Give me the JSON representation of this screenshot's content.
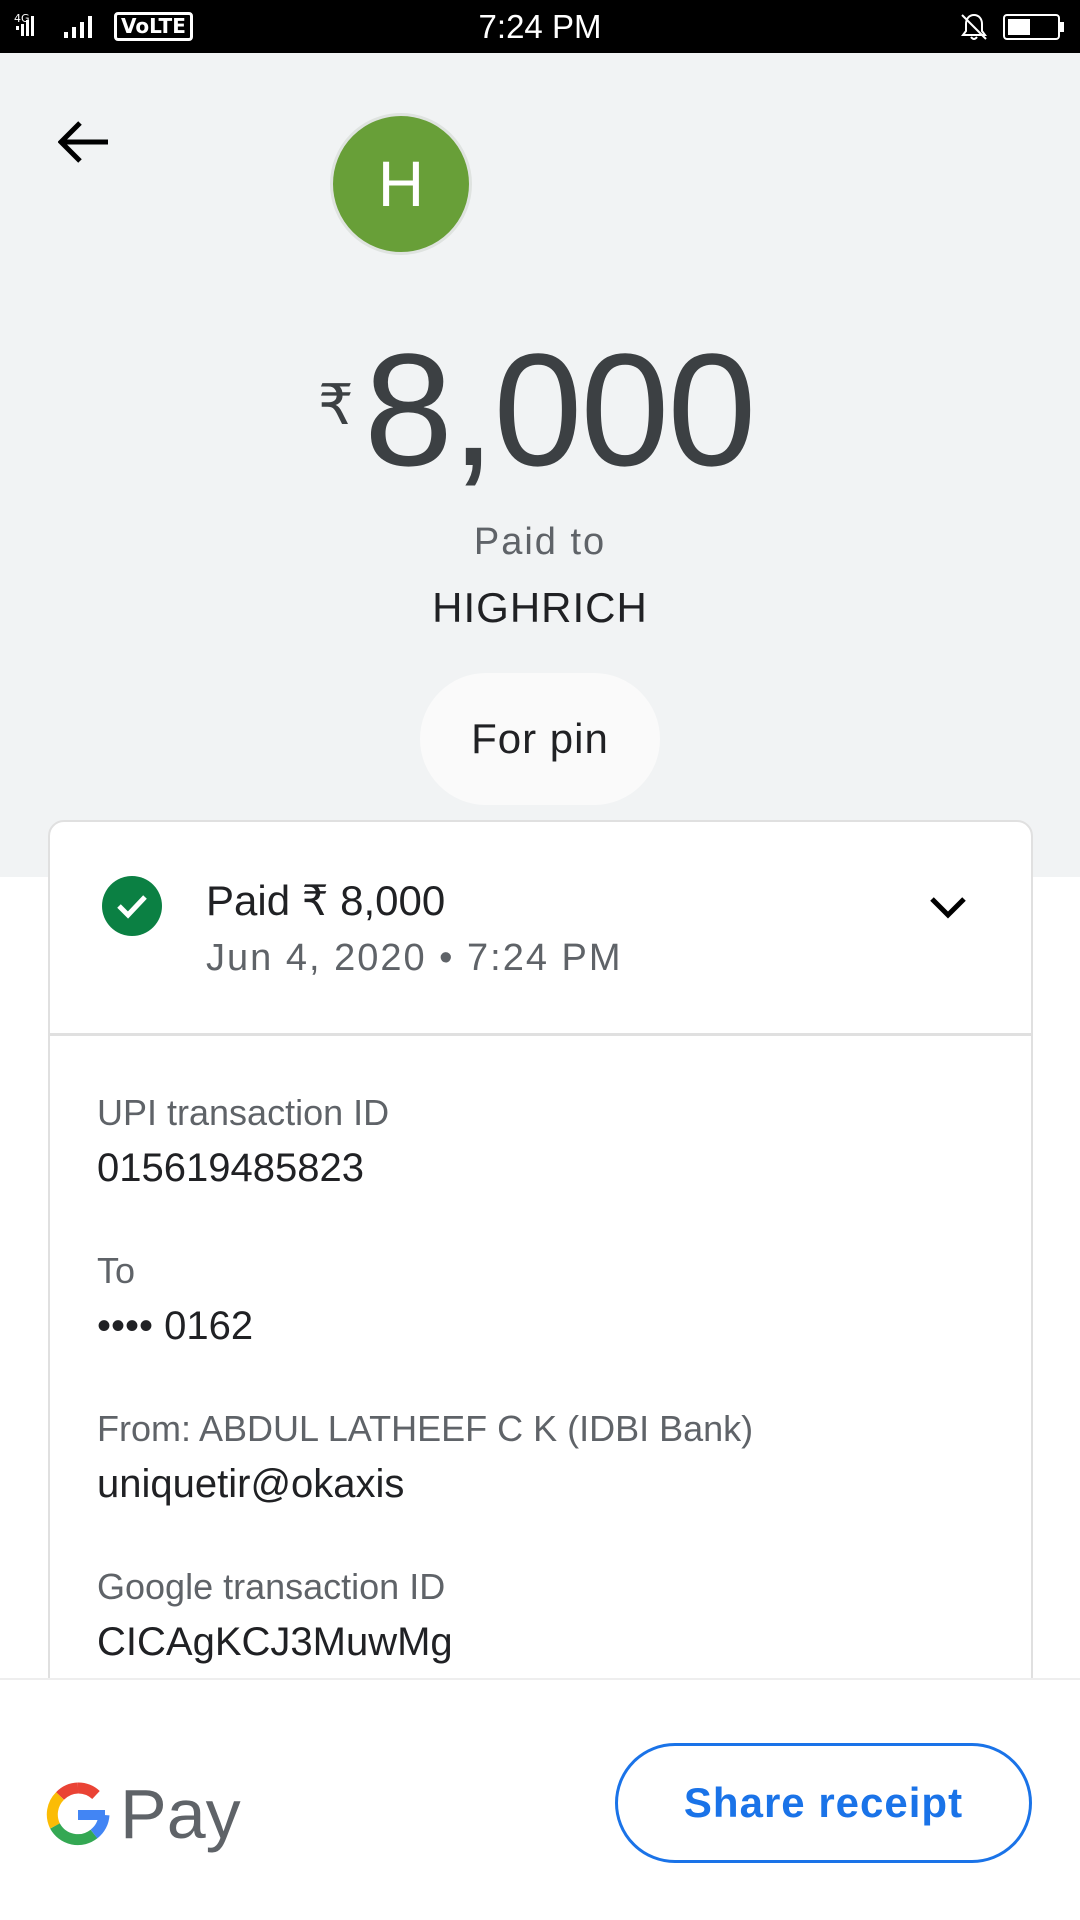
{
  "status_bar": {
    "network": "4G",
    "volte": "VoLTE",
    "time": "7:24 PM",
    "icons": [
      "signal-icon",
      "volte-icon",
      "bell-muted-icon",
      "battery-icon"
    ]
  },
  "header": {
    "back_icon": "arrow-back-icon",
    "avatar_initial": "H",
    "avatar_color": "#689f38",
    "currency_symbol": "₹",
    "amount": "8,000",
    "paid_to_label": "Paid to",
    "payee": "HIGHRICH",
    "note": "For pin"
  },
  "transaction": {
    "status_icon": "check-circle-icon",
    "status_color": "#0b8043",
    "title": "Paid ₹ 8,000",
    "date": "Jun 4, 2020 • 7:24 PM",
    "expand_icon": "chevron-down-icon",
    "details": [
      {
        "label": "UPI transaction ID",
        "value": "015619485823"
      },
      {
        "label": "To",
        "value": "•••• 0162"
      },
      {
        "label": "From: ABDUL LATHEEF C K (IDBI Bank)",
        "value": "uniquetir@okaxis"
      },
      {
        "label": "Google transaction ID",
        "value": "CICAgKCJ3MuwMg"
      }
    ]
  },
  "footer": {
    "logo_text": "Pay",
    "share_label": "Share receipt",
    "accent_color": "#1a73e8"
  }
}
